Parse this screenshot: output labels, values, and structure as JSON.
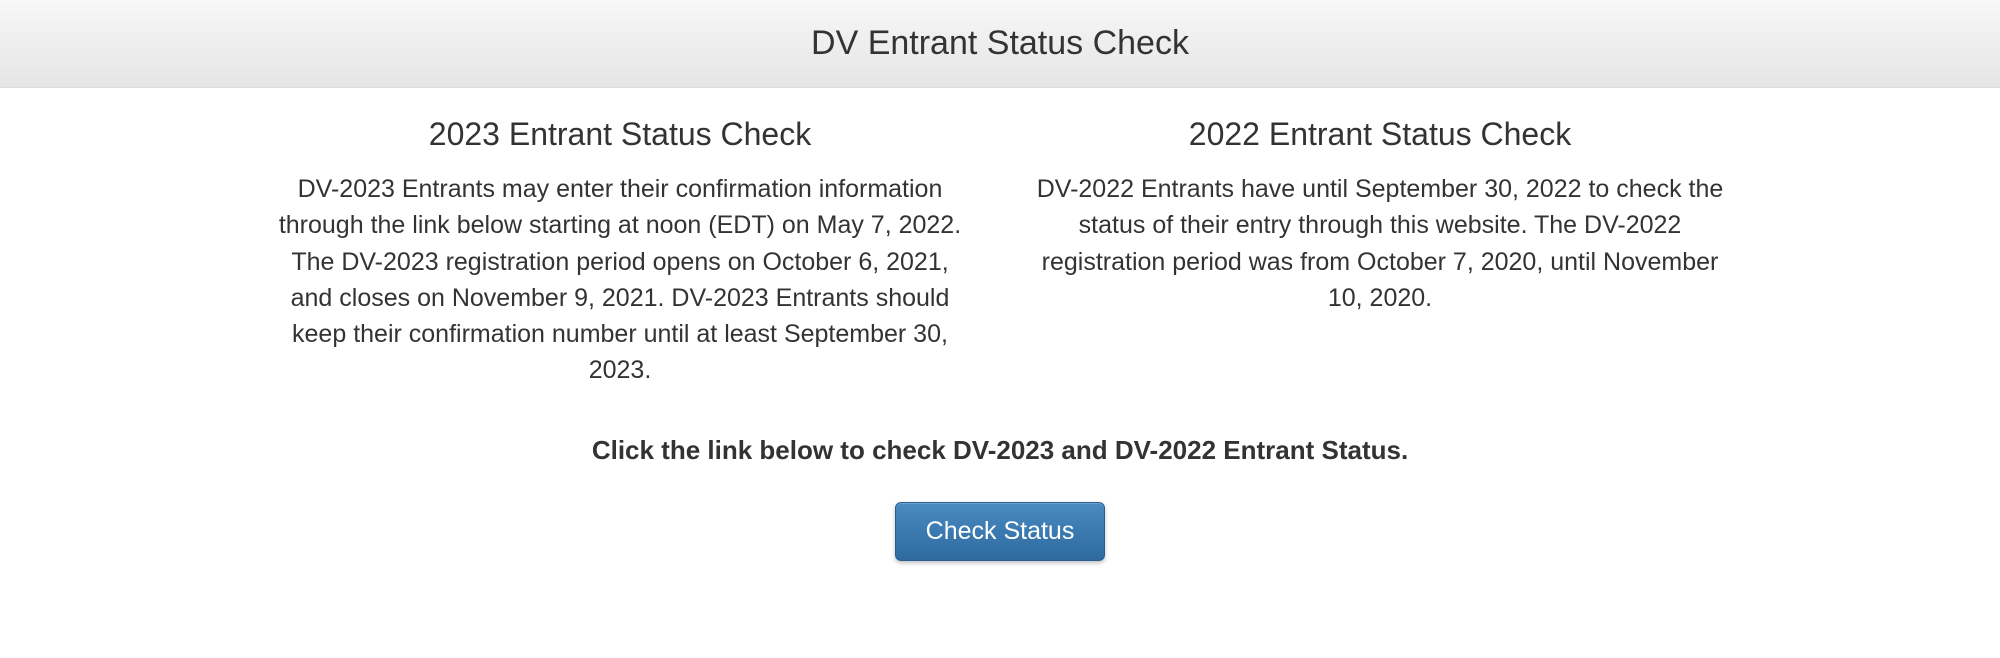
{
  "header": {
    "title": "DV Entrant Status Check"
  },
  "columns": {
    "left": {
      "heading": "2023 Entrant Status Check",
      "body": "DV-2023 Entrants may enter their confirmation information through the link below starting at noon (EDT) on May 7, 2022. The DV-2023 registration period opens on October 6, 2021, and closes on November 9, 2021. DV-2023 Entrants should keep their confirmation number until at least September 30, 2023."
    },
    "right": {
      "heading": "2022 Entrant Status Check",
      "body": "DV-2022 Entrants have until September 30, 2022 to check the status of their entry through this website. The DV-2022 registration period was from October 7, 2020, until November 10, 2020."
    }
  },
  "instruction": "Click the link below to check DV-2023 and DV-2022 Entrant Status.",
  "button": {
    "check_status_label": "Check Status"
  }
}
